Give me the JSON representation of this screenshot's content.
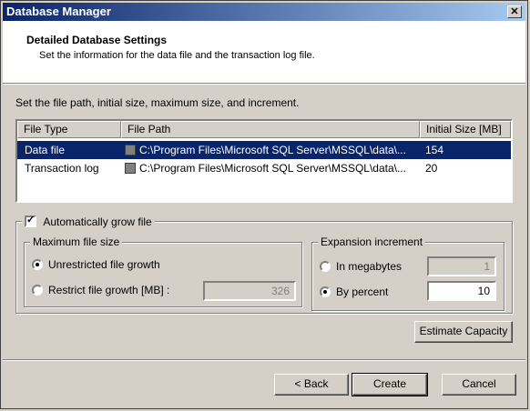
{
  "window": {
    "title": "Database Manager",
    "close_glyph": "✕"
  },
  "header": {
    "title": "Detailed Database Settings",
    "subtitle": "Set the information for the data file and the transaction log file."
  },
  "instruction": "Set the file path, initial size, maximum size, and increment.",
  "table": {
    "columns": [
      "File Type",
      "File Path",
      "Initial Size [MB]"
    ],
    "rows": [
      {
        "type": "Data file",
        "path": "C:\\Program Files\\Microsoft SQL Server\\MSSQL\\data\\...",
        "size": "154",
        "selected": true
      },
      {
        "type": "Transaction log",
        "path": "C:\\Program Files\\Microsoft SQL Server\\MSSQL\\data\\...",
        "size": "20",
        "selected": false
      }
    ]
  },
  "autogrow": {
    "label": "Automatically grow file",
    "checked": true
  },
  "max_size": {
    "label": "Maximum file size",
    "unrestricted_label": "Unrestricted file growth",
    "restrict_label": "Restrict file growth [MB] :",
    "restrict_value": "326",
    "selected": "unrestricted"
  },
  "increment": {
    "label": "Expansion increment",
    "megabytes_label": "In megabytes",
    "megabytes_value": "1",
    "percent_label": "By percent",
    "percent_value": "10",
    "selected": "percent"
  },
  "buttons": {
    "estimate": "Estimate Capacity",
    "back": "< Back",
    "create": "Create",
    "cancel": "Cancel"
  }
}
